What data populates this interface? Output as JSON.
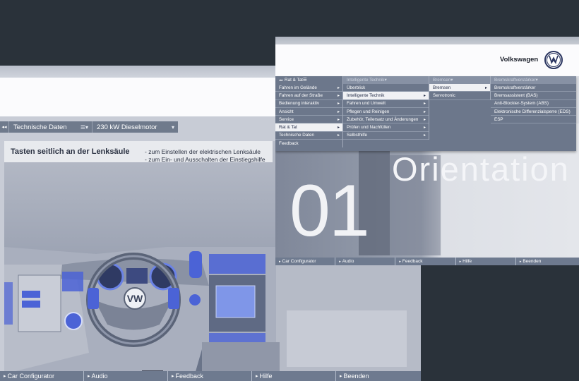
{
  "back_window": {
    "nav": {
      "section_label": "Technische Daten",
      "engine_label": "230 kW Dieselmotor"
    },
    "caption": {
      "title": "Tasten seitlich an der Lenksäule",
      "line1": "- zum Einstellen der elektrischen Lenksäule",
      "line2": "- zum Ein- und Ausschalten der Einstiegshilfe"
    },
    "bottom_bar": [
      "Car Configurator",
      "Audio",
      "Feedback",
      "Hilfe",
      "Beenden"
    ]
  },
  "front_window": {
    "brand": "Volkswagen",
    "menu": {
      "col1_header": "Rat & Tat",
      "col1_items": [
        "Fahren im Gelände",
        "Fahren auf der Straße",
        "Bedienung interaktiv",
        "Ansicht",
        "Service",
        "Rat & Tat",
        "Technische Daten",
        "Feedback"
      ],
      "col2_header": "Intelligente Technik",
      "col2_items": [
        "Überblick",
        "Intelligente Technik",
        "Fahren und Umwelt",
        "Pflegen und Reinigen",
        "Zubehör, Teilersatz und Änderungen",
        "Prüfen und Nachfüllen",
        "Selbsthilfe"
      ],
      "col3_header": "Bremsen",
      "col3_items": [
        "Bremsen",
        "Servotronic"
      ],
      "col4_header": "Bremskraftverstärker",
      "col4_items": [
        "Bremskraftverstärker",
        "Bremsassistent (BAS)",
        "Anti-Blockier-System (ABS)",
        "Elektronische Differenzialsperre (EDS)",
        "ESP"
      ]
    },
    "hero": {
      "number": "01",
      "title": "Orientation"
    },
    "bottom_bar": [
      "Car Configurator",
      "Audio",
      "Feedback",
      "Hilfe",
      "Beenden"
    ]
  },
  "colors": {
    "desktop": "#2a323a",
    "nav_blue_gray": "#6f7a8c",
    "highlight_blue": "#4b63d6"
  }
}
